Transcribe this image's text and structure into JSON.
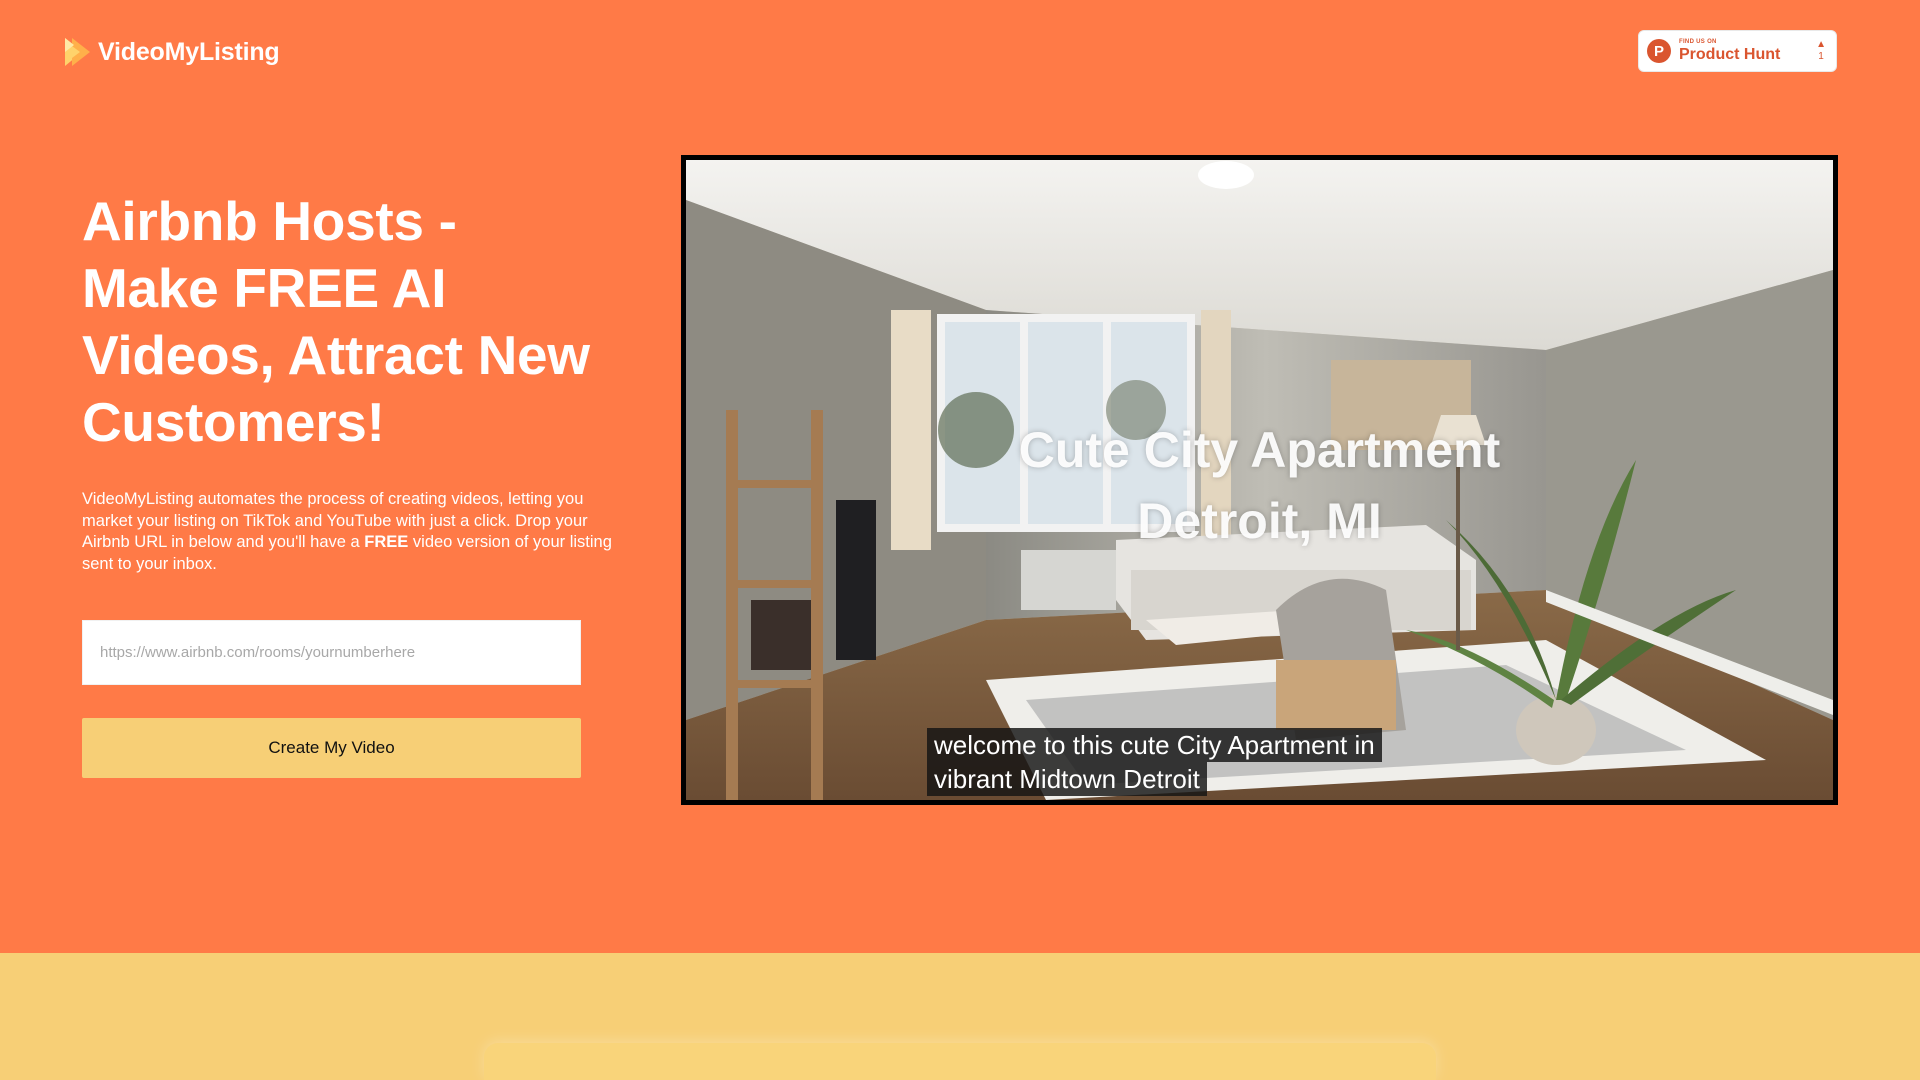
{
  "brand": {
    "name": "VideoMyListing"
  },
  "product_hunt": {
    "small": "FIND US ON",
    "big": "Product Hunt",
    "logo_letter": "P",
    "arrow": "▲",
    "count": "1"
  },
  "hero": {
    "headline_lines": [
      "Airbnb Hosts -",
      "Make FREE AI",
      "Videos, Attract New",
      "Customers!"
    ],
    "description": {
      "before_bold": "VideoMyListing automates the process of creating videos, letting you market your listing on TikTok and YouTube with just a click. Drop your Airbnb URL in below and you'll have a ",
      "bold": "FREE",
      "after_bold": " video version of your listing sent to your inbox."
    },
    "url_input": {
      "placeholder": "https://www.airbnb.com/rooms/yournumberhere",
      "value": ""
    },
    "cta_label": "Create My Video"
  },
  "video": {
    "title_line1": "Cute City Apartment",
    "title_line2": "Detroit, MI",
    "caption_line1": "welcome to this cute City Apartment in",
    "caption_line2": "vibrant Midtown Detroit"
  },
  "colors": {
    "hero_bg": "#FF7A47",
    "band_bg": "#F7CF76",
    "cta_bg": "#F7CF76",
    "product_hunt": "#DA552F"
  },
  "icons": {
    "logo": "play-arrow-logo-icon",
    "product_hunt": "product-hunt-p-icon",
    "vote": "upvote-arrow-icon"
  }
}
